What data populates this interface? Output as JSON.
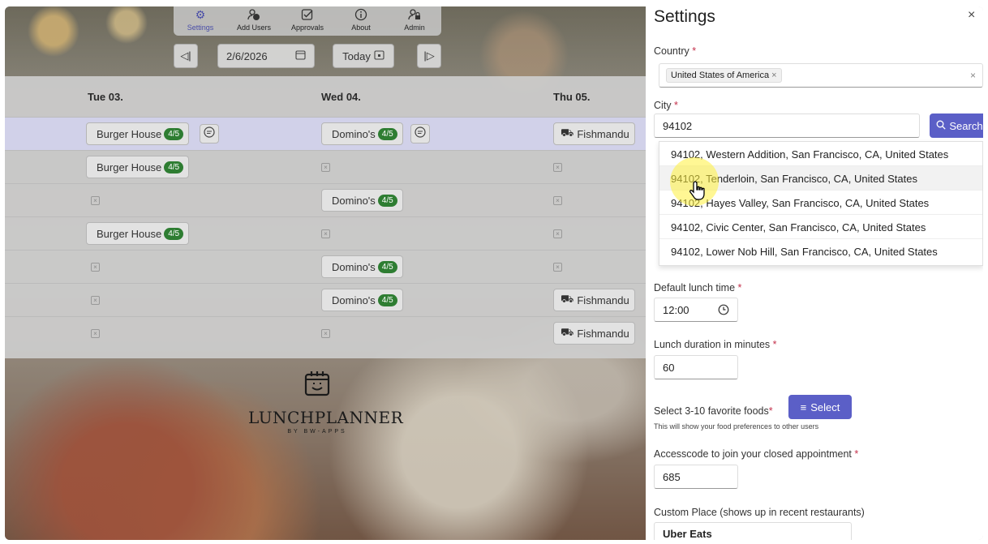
{
  "nav": {
    "items": [
      {
        "label": "Settings",
        "icon": "gear-icon"
      },
      {
        "label": "Add Users",
        "icon": "add-user-icon"
      },
      {
        "label": "Approvals",
        "icon": "approvals-icon"
      },
      {
        "label": "About",
        "icon": "info-icon"
      },
      {
        "label": "Admin",
        "icon": "admin-icon"
      }
    ]
  },
  "datebar": {
    "prev_icon": "◁|",
    "date": "2/6/2026",
    "today": "Today",
    "next_icon": "|▷"
  },
  "grid": {
    "columns": [
      "Tue 03.",
      "Wed 04.",
      "Thu 05."
    ],
    "cells": {
      "burger": "Burger House",
      "dominos": "Domino's",
      "fish": "Fishmandu",
      "badge": "4/5"
    }
  },
  "logo": {
    "name": "LUNCHPLANNER",
    "by": "BY BW-APPS"
  },
  "settings": {
    "title": "Settings",
    "close": "×",
    "country_label": "Country",
    "country_value": "United States of America",
    "city_label": "City",
    "city_value": "94102",
    "search_label": "Search",
    "suggestions": [
      "94102, Western Addition, San Francisco, CA, United States",
      "94102, Tenderloin, San Francisco, CA, United States",
      "94102, Hayes Valley, San Francisco, CA, United States",
      "94102, Civic Center, San Francisco, CA, United States",
      "94102, Lower Nob Hill, San Francisco, CA, United States"
    ],
    "lunch_time_label": "Default lunch time",
    "lunch_time_value": "12:00",
    "duration_label": "Lunch duration in minutes",
    "duration_value": "60",
    "foods_label": "Select 3-10 favorite foods",
    "foods_button": "Select",
    "foods_hint": "This will show your food preferences to other users",
    "access_label": "Accesscode to join your closed appointment",
    "access_value": "685",
    "custom_label": "Custom Place (shows up in recent restaurants)",
    "custom_value": "Uber Eats",
    "required_mark": "*"
  },
  "colors": {
    "accent": "#5b5fc7",
    "badge": "#2e7d32",
    "required": "#c4314b"
  }
}
